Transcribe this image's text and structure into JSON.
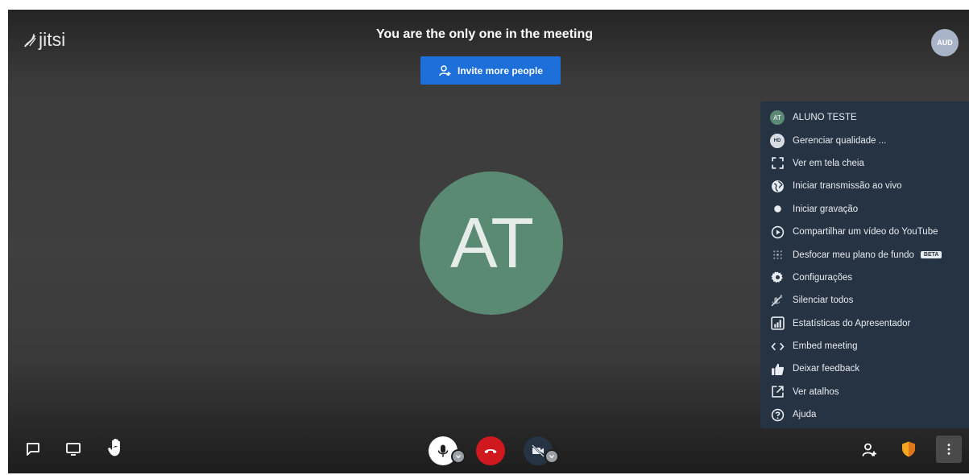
{
  "header": {
    "logo_text": "jitsi",
    "meeting_status": "You are the only one in the meeting",
    "invite_label": "Invite more people",
    "top_avatar_initials": "AUD"
  },
  "main": {
    "participant_initials": "AT",
    "avatar_color": "#5b8a74"
  },
  "more_menu": {
    "items": [
      {
        "label": "ALUNO TESTE",
        "icon": "avatar-icon"
      },
      {
        "label": "Gerenciar qualidade ...",
        "icon": "hd-icon",
        "icon_text": "HD"
      },
      {
        "label": "Ver em tela cheia",
        "icon": "fullscreen-icon"
      },
      {
        "label": "Iniciar transmissão ao vivo",
        "icon": "globe-icon"
      },
      {
        "label": "Iniciar gravação",
        "icon": "record-icon"
      },
      {
        "label": "Compartilhar um vídeo do YouTube",
        "icon": "play-circle-icon"
      },
      {
        "label": "Desfocar meu plano de fundo",
        "icon": "blur-icon",
        "badge": "BETA"
      },
      {
        "label": "Configurações",
        "icon": "gear-icon"
      },
      {
        "label": "Silenciar todos",
        "icon": "mute-all-icon"
      },
      {
        "label": "Estatísticas do Apresentador",
        "icon": "stats-icon"
      },
      {
        "label": "Embed meeting",
        "icon": "code-icon"
      },
      {
        "label": "Deixar feedback",
        "icon": "thumbs-up-icon"
      },
      {
        "label": "Ver atalhos",
        "icon": "external-link-icon"
      },
      {
        "label": "Ajuda",
        "icon": "help-icon"
      }
    ]
  },
  "colors": {
    "accent": "#1e6fd9",
    "hangup": "#d0191e",
    "menu_bg": "#263343",
    "security_shield": "#f5a623"
  }
}
